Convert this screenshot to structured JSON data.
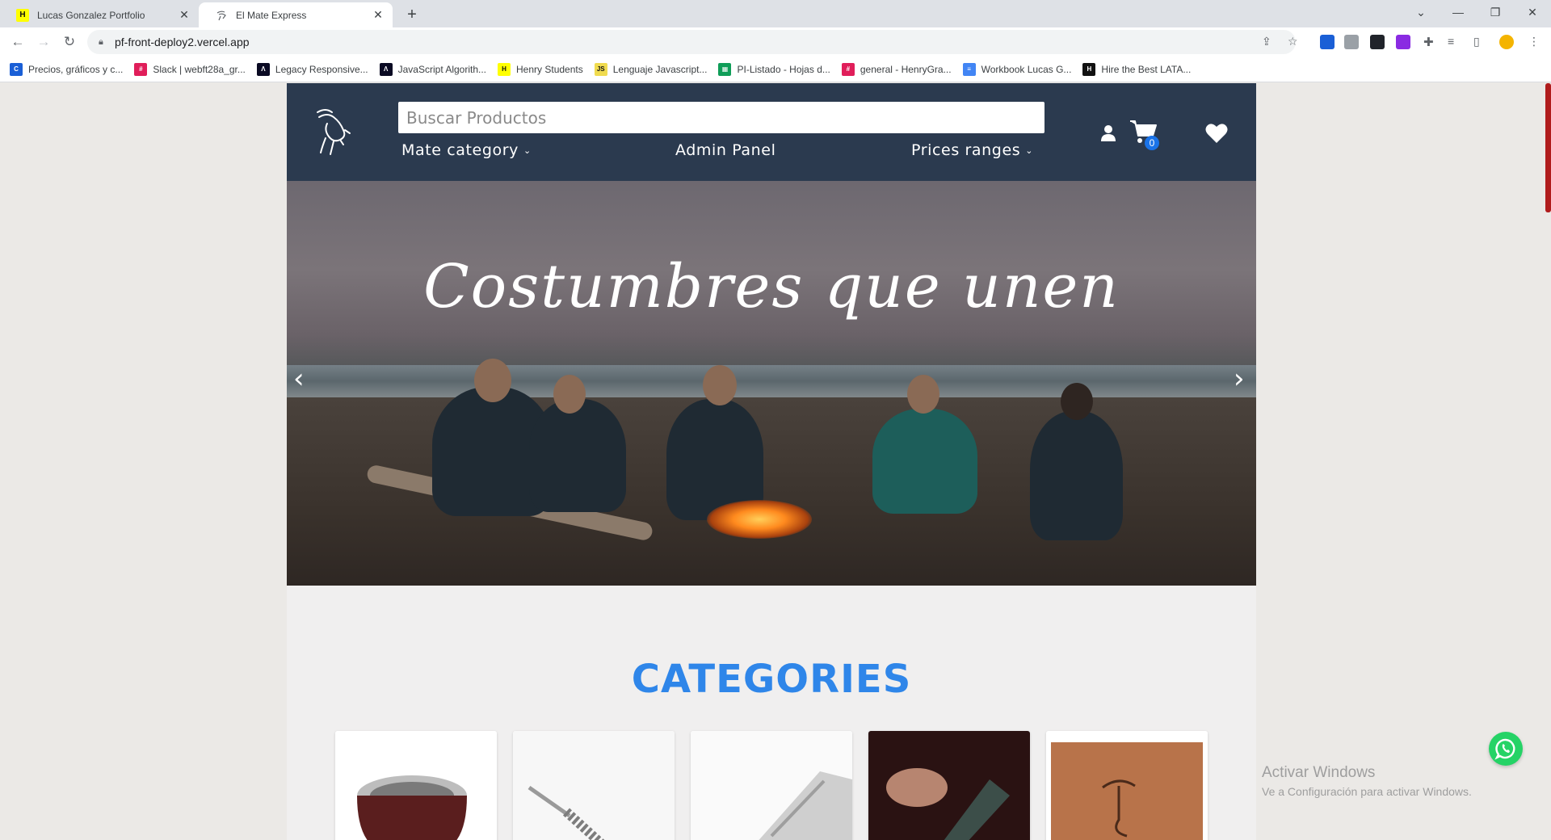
{
  "browser": {
    "tabs": [
      {
        "title": "Lucas Gonzalez Portfolio",
        "icon": "henry-favicon"
      },
      {
        "title": "El Mate Express",
        "icon": "mate-bird-favicon"
      }
    ],
    "url": "pf-front-deploy2.vercel.app",
    "bookmarks": [
      {
        "label": "Precios, gráficos y c...",
        "icon": "coingecko-icon",
        "color": "#1a5fd6"
      },
      {
        "label": "Slack | webft28a_gr...",
        "icon": "slack-icon",
        "color": "#e01e5a"
      },
      {
        "label": "Legacy Responsive...",
        "icon": "freecodecamp-icon",
        "color": "#0a0a23"
      },
      {
        "label": "JavaScript Algorith...",
        "icon": "freecodecamp-icon",
        "color": "#0a0a23"
      },
      {
        "label": "Henry Students",
        "icon": "henry-icon",
        "color": "#ffff01"
      },
      {
        "label": "Lenguaje Javascript...",
        "icon": "js-icon",
        "color": "#f0db4f"
      },
      {
        "label": "PI-Listado - Hojas d...",
        "icon": "sheets-icon",
        "color": "#0f9d58"
      },
      {
        "label": "general - HenryGra...",
        "icon": "slack-icon",
        "color": "#e01e5a"
      },
      {
        "label": "Workbook Lucas G...",
        "icon": "docs-icon",
        "color": "#4285f4"
      },
      {
        "label": "Hire the Best LATA...",
        "icon": "henry-icon",
        "color": "#111111"
      }
    ]
  },
  "header": {
    "search_placeholder": "Buscar Productos",
    "nav": {
      "mate_category": "Mate category",
      "admin_panel": "Admin Panel",
      "prices_ranges": "Prices ranges"
    },
    "cart_count": "0"
  },
  "hero": {
    "title": "Costumbres que unen"
  },
  "categories": {
    "title": "CATEGORIES",
    "cards": [
      {
        "image": "mate-gourd"
      },
      {
        "image": "bombilla-straw"
      },
      {
        "image": "silver-mate-detail"
      },
      {
        "image": "thermos-pouring"
      },
      {
        "image": "leather-bag"
      }
    ]
  },
  "os_overlay": {
    "line1": "Activar Windows",
    "line2": "Ve a Configuración para activar Windows."
  },
  "colors": {
    "header_bg": "#2b3a4f",
    "accent_blue": "#2f86e9",
    "whatsapp_green": "#25d366"
  }
}
